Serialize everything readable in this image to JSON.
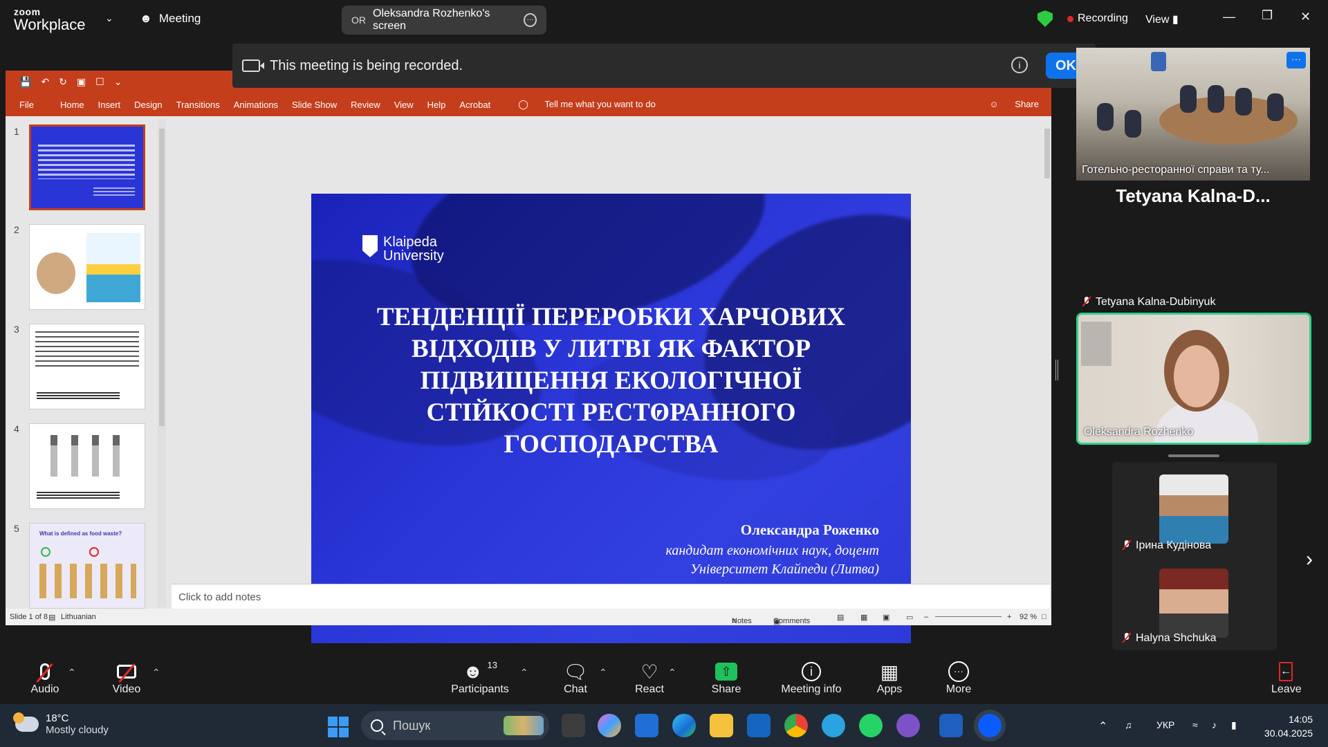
{
  "app": {
    "logo_line1": "zoom",
    "logo_line2": "Workplace",
    "meeting_label": "Meeting",
    "share_initials": "OR",
    "share_title": "Oleksandra Rozhenko's screen",
    "recording_label": "Recording",
    "view_label": "View",
    "accent_color": "#0e72ed",
    "record_color": "#e02828"
  },
  "banner": {
    "text": "This meeting is being recorded.",
    "ok_label": "OK"
  },
  "ppt": {
    "menu": [
      "File",
      "Home",
      "Insert",
      "Design",
      "Transitions",
      "Animations",
      "Slide Show",
      "Review",
      "View",
      "Help",
      "Acrobat",
      "Tell me what you want to do"
    ],
    "share_label": "Share",
    "accent_color": "#c43e1c",
    "slide_numbers": [
      "1",
      "2",
      "3",
      "4",
      "5"
    ],
    "thumb5_title": "What is defined as food waste?",
    "slide": {
      "logo_line1": "Klaipeda",
      "logo_line2": "University",
      "title": "ТЕНДЕНЦІЇ ПЕРЕРОБКИ ХАРЧОВИХ\nВІДХОДІВ У ЛИТВІ ЯК ФАКТОР\nПІДВИЩЕННЯ ЕКОЛОГІЧНОЇ\nСТІЙКОСТІ РЕСТОРАННОГО\nГОСПОДАРСТВА",
      "author": "Олександра Роженко",
      "role": "кандидат економічних наук, доцент",
      "university": "Університет Клайпеди (Литва)"
    },
    "notes_placeholder": "Click to add notes",
    "status": {
      "slide_counter": "Slide 1 of 8",
      "language": "Lithuanian",
      "notes": "Notes",
      "comments": "Comments",
      "zoom": "92 %"
    }
  },
  "participants": {
    "room_name": "Готельно-ресторанної справи та ту...",
    "big_name": "Tetyana  Kalna-D...",
    "tetyana": "Tetyana Kalna-Dubinyuk",
    "speaker": "Oleksandra Rozhenko",
    "iryna": "Ірина  Кудінова",
    "halyna": "Halyna Shchuka"
  },
  "toolbar": {
    "audio": "Audio",
    "video": "Video",
    "participants": "Participants",
    "participants_count": "13",
    "chat": "Chat",
    "react": "React",
    "share": "Share",
    "meeting_info": "Meeting info",
    "apps": "Apps",
    "more": "More",
    "leave": "Leave"
  },
  "taskbar": {
    "temp": "18°C",
    "weather": "Mostly cloudy",
    "search_placeholder": "Пошук",
    "lang": "УКР",
    "time": "14:05",
    "date": "30.04.2025"
  }
}
